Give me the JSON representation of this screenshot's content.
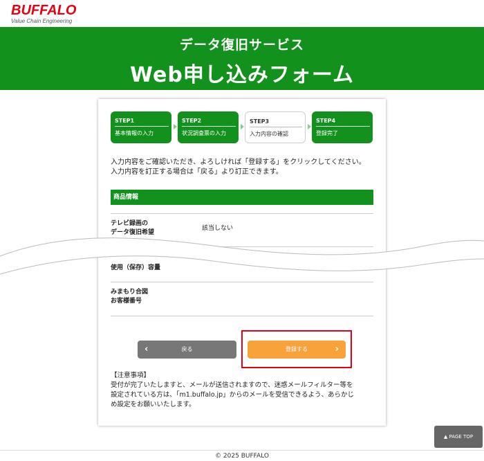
{
  "header": {
    "logo": "BUFFALO",
    "tagline": "Value Chain Engineering"
  },
  "banner": {
    "subtitle": "データ復旧サービス",
    "title": "Web申し込みフォーム"
  },
  "steps": [
    {
      "num": "STEP1",
      "label": "基本情報の入力",
      "state": "done"
    },
    {
      "num": "STEP2",
      "label": "状況調査票の入力",
      "state": "done"
    },
    {
      "num": "STEP3",
      "label": "入力内容の確認",
      "state": "current"
    },
    {
      "num": "STEP4",
      "label": "登録完了",
      "state": "done"
    }
  ],
  "intro": {
    "line1": "入力内容をご確認いただき、よろしければ「登録する」をクリックしてください。",
    "line2": "入力内容を訂正する場合は「戻る」より訂正できます。"
  },
  "section": {
    "title": "商品情報"
  },
  "rows": [
    {
      "label1": "テレビ録画の",
      "label2": "データ復旧希望",
      "value": "該当しない"
    },
    {
      "label1": "使用（保存）容量",
      "label2": "",
      "value": ""
    },
    {
      "label1": "みまもり合図",
      "label2": "お客様番号",
      "value": ""
    }
  ],
  "buttons": {
    "back": "戻る",
    "submit": "登録する",
    "back_chevron": "‹",
    "submit_chevron": "›"
  },
  "notes": {
    "heading": "【注意事項】",
    "line1": "受付が完了いたしますと、メールが送信されますので、迷惑メールフィルター等を",
    "line2": "設定されている方は、「m1.buffalo.jp」からのメールを受信できるよう、あらかじ",
    "line3": "め設定をお願いいたします。"
  },
  "page_top": {
    "label": "▲ PAGE TOP"
  },
  "footer": {
    "copyright": "© 2025 BUFFALO"
  },
  "colors": {
    "brand_green": "#12911c",
    "logo_red": "#e60012",
    "submit_orange": "#f7a23a",
    "back_gray": "#777777"
  }
}
